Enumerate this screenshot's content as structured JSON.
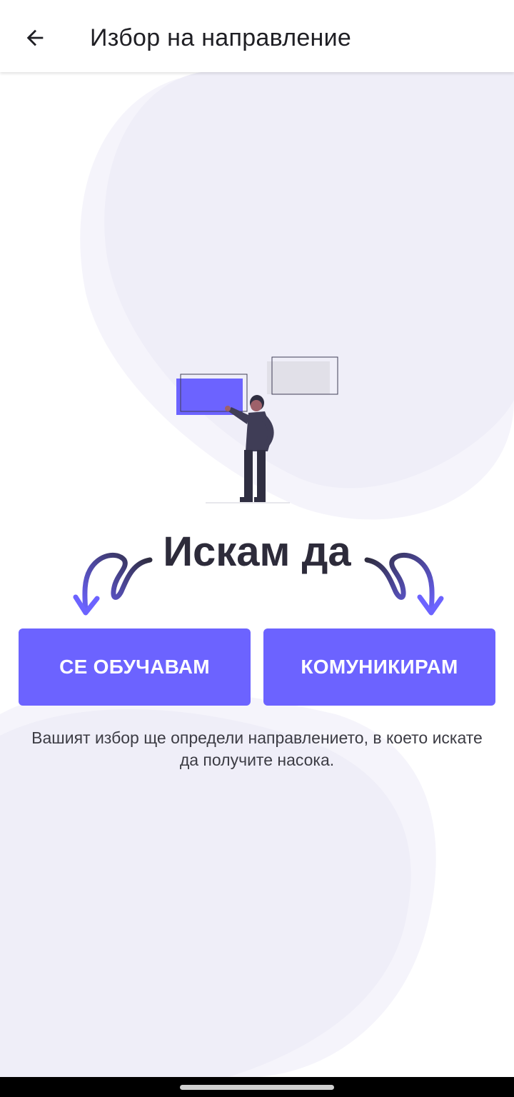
{
  "header": {
    "title": "Избор на направление",
    "back_icon": "arrow-left-icon"
  },
  "main": {
    "headline": "Искам да",
    "buttons": {
      "learn_label": "СЕ ОБУЧАВАМ",
      "communicate_label": "КОМУНИКИРАМ"
    },
    "caption": "Вашият избор ще определи направлението, в което искате да получите насока."
  },
  "colors": {
    "accent": "#6c63ff",
    "blob": "#efeef8",
    "headline": "#2d2b3a"
  }
}
